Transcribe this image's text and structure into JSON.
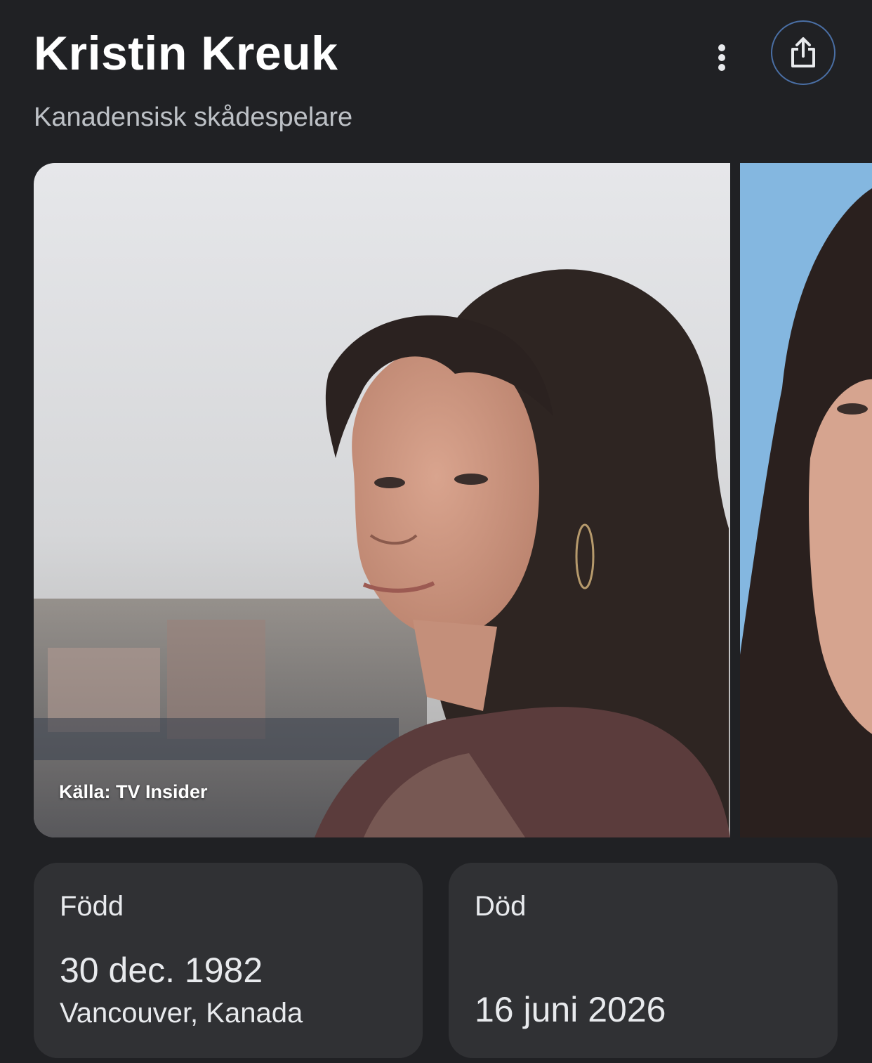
{
  "header": {
    "title": "Kristin Kreuk",
    "subtitle": "Kanadensisk skådespelare",
    "more_icon": "more-vert-icon",
    "share_icon": "share-icon"
  },
  "images": {
    "main_caption": "Källa: TV Insider"
  },
  "born": {
    "label": "Född",
    "date": "30 dec. 1982",
    "place": "Vancouver, Kanada"
  },
  "died": {
    "label": "Död",
    "date": "16 juni 2026"
  },
  "colors": {
    "background": "#202124",
    "card": "#303134",
    "share_border": "#4a6fa5"
  }
}
